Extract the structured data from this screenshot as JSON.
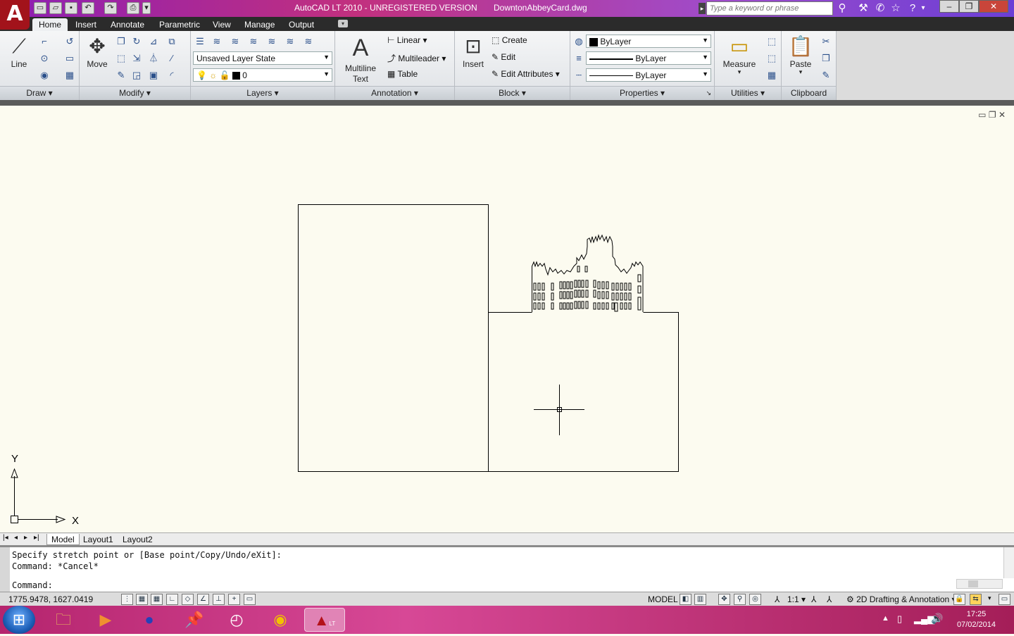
{
  "title_bar": {
    "app_title": "AutoCAD LT 2010 - UNREGISTERED VERSION",
    "file_name": "DowntonAbbeyCard.dwg",
    "search_placeholder": "Type a keyword or phrase",
    "app_logo": "A"
  },
  "ribbon_tabs": [
    "Home",
    "Insert",
    "Annotate",
    "Parametric",
    "View",
    "Manage",
    "Output"
  ],
  "ribbon": {
    "draw": {
      "line": "Line",
      "label": "Draw"
    },
    "modify": {
      "move": "Move",
      "label": "Modify"
    },
    "layers": {
      "layer_state": "Unsaved Layer State",
      "current_layer": "0",
      "label": "Layers"
    },
    "annotation": {
      "multiline_text_1": "Multiline",
      "multiline_text_2": "Text",
      "linear": "Linear",
      "multileader": "Multileader",
      "table": "Table",
      "label": "Annotation"
    },
    "block": {
      "insert": "Insert",
      "create": "Create",
      "edit": "Edit",
      "edit_attributes": "Edit Attributes",
      "label": "Block"
    },
    "properties": {
      "color": "ByLayer",
      "linetype": "ByLayer",
      "lineweight": "ByLayer",
      "label": "Properties"
    },
    "utilities": {
      "measure": "Measure",
      "label": "Utilities"
    },
    "clipboard": {
      "paste": "Paste",
      "label": "Clipboard"
    }
  },
  "axes": {
    "x": "X",
    "y": "Y"
  },
  "layout_tabs": [
    "Model",
    "Layout1",
    "Layout2"
  ],
  "command": {
    "line1": "Specify stretch point or [Base point/Copy/Undo/eXit]:",
    "line2": "Command: *Cancel*",
    "prompt": "Command:"
  },
  "status": {
    "coordinates": "1775.9478, 1627.0419",
    "space": "MODEL",
    "scale": "1:1",
    "workspace": "2D Drafting & Annotation"
  },
  "taskbar": {
    "time": "17:25",
    "date": "07/02/2014",
    "active_app_label": "LT"
  }
}
